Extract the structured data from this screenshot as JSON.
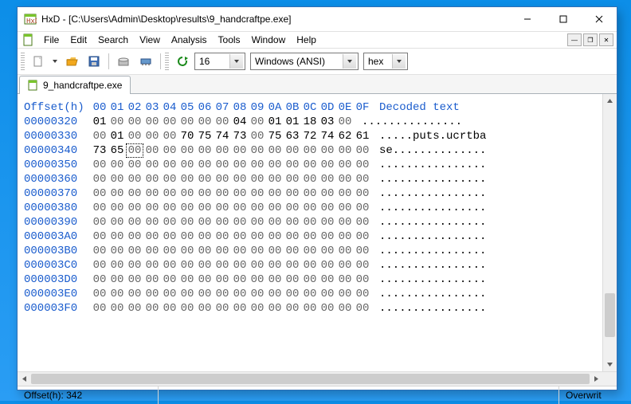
{
  "titlebar": {
    "title": "HxD - [C:\\Users\\Admin\\Desktop\\results\\9_handcraftpe.exe]"
  },
  "menu": {
    "file": "File",
    "edit": "Edit",
    "search": "Search",
    "view": "View",
    "analysis": "Analysis",
    "tools": "Tools",
    "window": "Window",
    "help": "Help"
  },
  "toolbar": {
    "bytes_per_row": "16",
    "charset": "Windows (ANSI)",
    "base": "hex"
  },
  "tab": {
    "label": "9_handcraftpe.exe"
  },
  "hex": {
    "offset_hdr": "Offset(h)",
    "cols": [
      "00",
      "01",
      "02",
      "03",
      "04",
      "05",
      "06",
      "07",
      "08",
      "09",
      "0A",
      "0B",
      "0C",
      "0D",
      "0E",
      "0F"
    ],
    "decoded_hdr": "Decoded text",
    "rows": [
      {
        "off": "00000320",
        "b": [
          "01",
          "00",
          "00",
          "00",
          "00",
          "00",
          "00",
          "00",
          "04",
          "00",
          "01",
          "01",
          "18",
          "03",
          "00"
        ],
        "d": "..............."
      },
      {
        "off": "00000330",
        "b": [
          "00",
          "01",
          "00",
          "00",
          "00",
          "70",
          "75",
          "74",
          "73",
          "00",
          "75",
          "63",
          "72",
          "74",
          "62",
          "61"
        ],
        "d": ".....puts.ucrtba"
      },
      {
        "off": "00000340",
        "b": [
          "73",
          "65",
          "00",
          "00",
          "00",
          "00",
          "00",
          "00",
          "00",
          "00",
          "00",
          "00",
          "00",
          "00",
          "00",
          "00"
        ],
        "d": "se.............."
      },
      {
        "off": "00000350",
        "b": [
          "00",
          "00",
          "00",
          "00",
          "00",
          "00",
          "00",
          "00",
          "00",
          "00",
          "00",
          "00",
          "00",
          "00",
          "00",
          "00"
        ],
        "d": "................"
      },
      {
        "off": "00000360",
        "b": [
          "00",
          "00",
          "00",
          "00",
          "00",
          "00",
          "00",
          "00",
          "00",
          "00",
          "00",
          "00",
          "00",
          "00",
          "00",
          "00"
        ],
        "d": "................"
      },
      {
        "off": "00000370",
        "b": [
          "00",
          "00",
          "00",
          "00",
          "00",
          "00",
          "00",
          "00",
          "00",
          "00",
          "00",
          "00",
          "00",
          "00",
          "00",
          "00"
        ],
        "d": "................"
      },
      {
        "off": "00000380",
        "b": [
          "00",
          "00",
          "00",
          "00",
          "00",
          "00",
          "00",
          "00",
          "00",
          "00",
          "00",
          "00",
          "00",
          "00",
          "00",
          "00"
        ],
        "d": "................"
      },
      {
        "off": "00000390",
        "b": [
          "00",
          "00",
          "00",
          "00",
          "00",
          "00",
          "00",
          "00",
          "00",
          "00",
          "00",
          "00",
          "00",
          "00",
          "00",
          "00"
        ],
        "d": "................"
      },
      {
        "off": "000003A0",
        "b": [
          "00",
          "00",
          "00",
          "00",
          "00",
          "00",
          "00",
          "00",
          "00",
          "00",
          "00",
          "00",
          "00",
          "00",
          "00",
          "00"
        ],
        "d": "................"
      },
      {
        "off": "000003B0",
        "b": [
          "00",
          "00",
          "00",
          "00",
          "00",
          "00",
          "00",
          "00",
          "00",
          "00",
          "00",
          "00",
          "00",
          "00",
          "00",
          "00"
        ],
        "d": "................"
      },
      {
        "off": "000003C0",
        "b": [
          "00",
          "00",
          "00",
          "00",
          "00",
          "00",
          "00",
          "00",
          "00",
          "00",
          "00",
          "00",
          "00",
          "00",
          "00",
          "00"
        ],
        "d": "................"
      },
      {
        "off": "000003D0",
        "b": [
          "00",
          "00",
          "00",
          "00",
          "00",
          "00",
          "00",
          "00",
          "00",
          "00",
          "00",
          "00",
          "00",
          "00",
          "00",
          "00"
        ],
        "d": "................"
      },
      {
        "off": "000003E0",
        "b": [
          "00",
          "00",
          "00",
          "00",
          "00",
          "00",
          "00",
          "00",
          "00",
          "00",
          "00",
          "00",
          "00",
          "00",
          "00",
          "00"
        ],
        "d": "................"
      },
      {
        "off": "000003F0",
        "b": [
          "00",
          "00",
          "00",
          "00",
          "00",
          "00",
          "00",
          "00",
          "00",
          "00",
          "00",
          "00",
          "00",
          "00",
          "00",
          "00"
        ],
        "d": "................"
      }
    ],
    "cursor": {
      "row": 2,
      "col": 2
    }
  },
  "status": {
    "offset_label": "Offset(h): 342",
    "mode": "Overwrit"
  }
}
